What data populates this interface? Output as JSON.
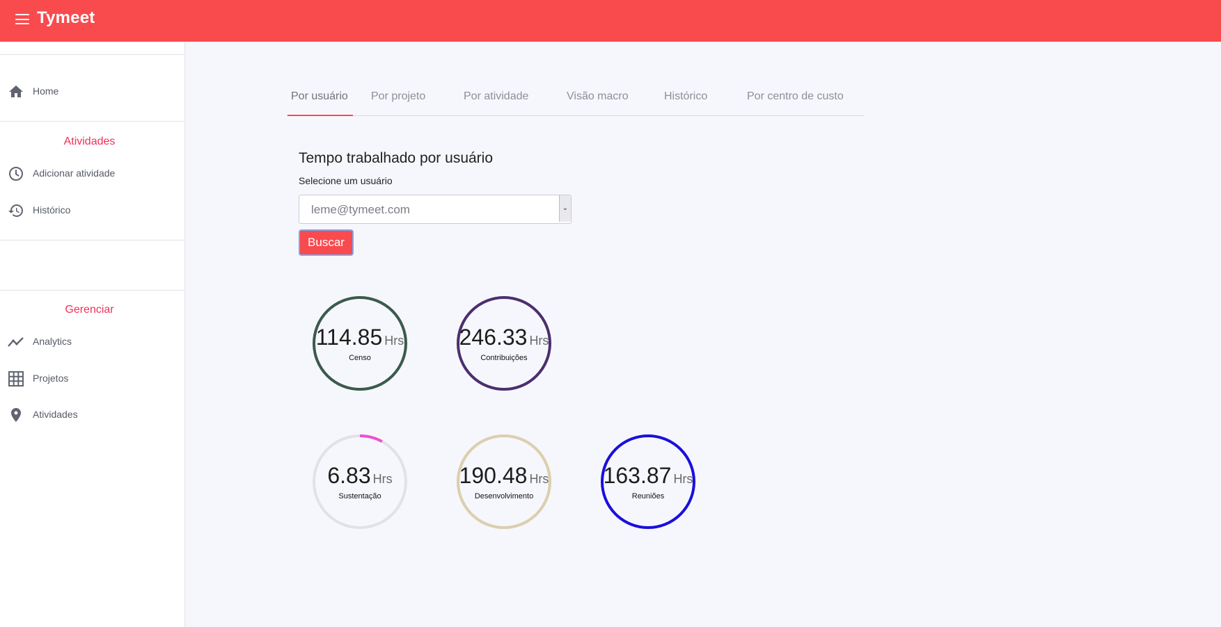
{
  "app": {
    "title": "Tymeet"
  },
  "sidebar": {
    "home": {
      "label": "Home",
      "icon": "home-icon"
    },
    "section_atividades": "Atividades",
    "atividades_items": [
      {
        "label": "Adicionar atividade",
        "icon": "clock-icon"
      },
      {
        "label": "Histórico",
        "icon": "history-icon"
      }
    ],
    "section_gerenciar": "Gerenciar",
    "gerenciar_items": [
      {
        "label": "Analytics",
        "icon": "trending-up-icon"
      },
      {
        "label": "Projetos",
        "icon": "grid-icon"
      },
      {
        "label": "Atividades",
        "icon": "location-pin-icon"
      }
    ]
  },
  "tabs": [
    {
      "label": "Por usuário",
      "active": true
    },
    {
      "label": "Por projeto",
      "active": false
    },
    {
      "label": "Por atividade",
      "active": false
    },
    {
      "label": "Visão macro",
      "active": false
    },
    {
      "label": "Histórico",
      "active": false
    },
    {
      "label": "Por centro de custo",
      "active": false
    }
  ],
  "main": {
    "heading": "Tempo trabalhado por usuário",
    "select_label": "Selecione um usuário",
    "selected_user": "leme@tymeet.com",
    "search_button": "Buscar"
  },
  "gauges": [
    {
      "value": "114.85",
      "unit": "Hrs",
      "label": "Censo",
      "color": "#3b5a4c",
      "fill": 1.0
    },
    {
      "value": "246.33",
      "unit": "Hrs",
      "label": "Contribuições",
      "color": "#4b2f6e",
      "fill": 1.0
    },
    {
      "value": "6.83",
      "unit": "Hrs",
      "label": "Sustentação",
      "color": "#ee4fd0",
      "fill": 0.08
    },
    {
      "value": "190.48",
      "unit": "Hrs",
      "label": "Desenvolvimento",
      "color": "#dccfad",
      "fill": 1.0
    },
    {
      "value": "163.87",
      "unit": "Hrs",
      "label": "Reuniões",
      "color": "#1a0fdc",
      "fill": 1.0
    }
  ],
  "colors": {
    "brand": "#f94a4e",
    "section_title": "#f0305a",
    "gauge_track": "#e2e2e6"
  }
}
